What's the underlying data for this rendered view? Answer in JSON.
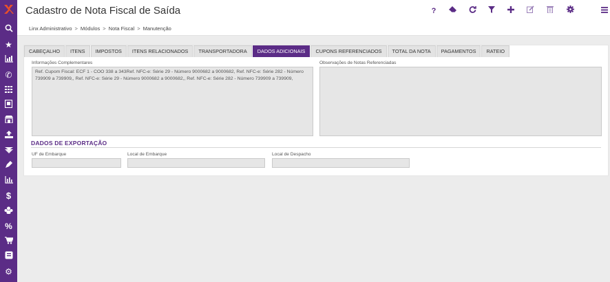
{
  "header": {
    "title": "Cadastro de Nota Fiscal de Saída",
    "breadcrumb": [
      "Linx Administrativo",
      "Módulos",
      "Nota Fiscal",
      "Manutenção"
    ],
    "breadcrumb_sep": ">",
    "help_label": "?"
  },
  "sidebar": {
    "icons": [
      "search-icon",
      "star-icon",
      "chart-icon",
      "phone-icon",
      "grid-icon",
      "document-icon",
      "store-icon",
      "upload-icon",
      "transfer-icon",
      "pen-icon",
      "bar-chart-icon",
      "dollar-icon",
      "group-icon",
      "percent-icon",
      "cart-icon",
      "receipt-icon",
      "settings-icon"
    ]
  },
  "tabs": [
    {
      "label": "CABEÇALHO",
      "active": false
    },
    {
      "label": "ITENS",
      "active": false
    },
    {
      "label": "IMPOSTOS",
      "active": false
    },
    {
      "label": "ITENS RELACIONADOS",
      "active": false
    },
    {
      "label": "TRANSPORTADORA",
      "active": false
    },
    {
      "label": "DADOS ADICIONAIS",
      "active": true
    },
    {
      "label": "CUPONS REFERENCIADOS",
      "active": false
    },
    {
      "label": "TOTAL DA NOTA",
      "active": false
    },
    {
      "label": "PAGAMENTOS",
      "active": false
    },
    {
      "label": "RATEIO",
      "active": false
    }
  ],
  "form": {
    "info_label": "Informações Complementares",
    "info_value": "Ref. Cupom Fiscal: ECF 1 - COO 338 a 343Ref. NFC-e: Série 29 - Número 9000682 a 9000682, Ref. NFC-e: Série 282 - Número 739909 a 739909,, Ref. NFC-e: Série 29 - Número 9000682 a 9000682,, Ref. NFC-e: Série 282 - Número 739909 a 739909,",
    "obs_label": "Observações de Notas Referenciadas",
    "obs_value": "",
    "export_title": "DADOS DE EXPORTAÇÃO",
    "uf_label": "UF de Embarque",
    "uf_value": "",
    "local_embarque_label": "Local de Embarque",
    "local_embarque_value": "",
    "local_despacho_label": "Local de Despacho",
    "local_despacho_value": ""
  },
  "colors": {
    "accent": "#5b2c86",
    "logo": "#e8502a"
  }
}
